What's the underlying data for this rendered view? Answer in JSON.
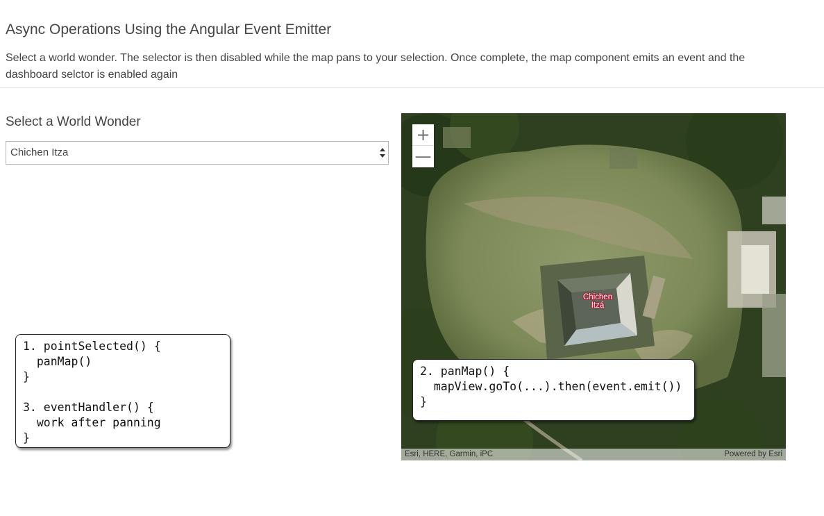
{
  "header": {
    "title": "Async Operations Using the Angular Event Emitter",
    "description": "Select a world wonder. The selector is then disabled while the map pans to your selection. Once complete, the map component emits an event and the dashboard selctor is enabled again"
  },
  "selector": {
    "label": "Select a World Wonder",
    "selected": "Chichen Itza"
  },
  "callouts": {
    "left_code": "1. pointSelected() {\n  panMap()\n}\n\n3. eventHandler() {\n  work after panning\n}",
    "right_code": "2. panMap() {\n  mapView.goTo(...).then(event.emit())\n}"
  },
  "map": {
    "zoom_in": "+",
    "zoom_out": "—",
    "marker_label": "Chichen Itzá",
    "attribution": "Esri, HERE, Garmin, iPC",
    "powered_by": "Powered by Esri"
  },
  "colors": {
    "map_label_halo": "#b3122e",
    "rule": "#dcdcdc"
  }
}
